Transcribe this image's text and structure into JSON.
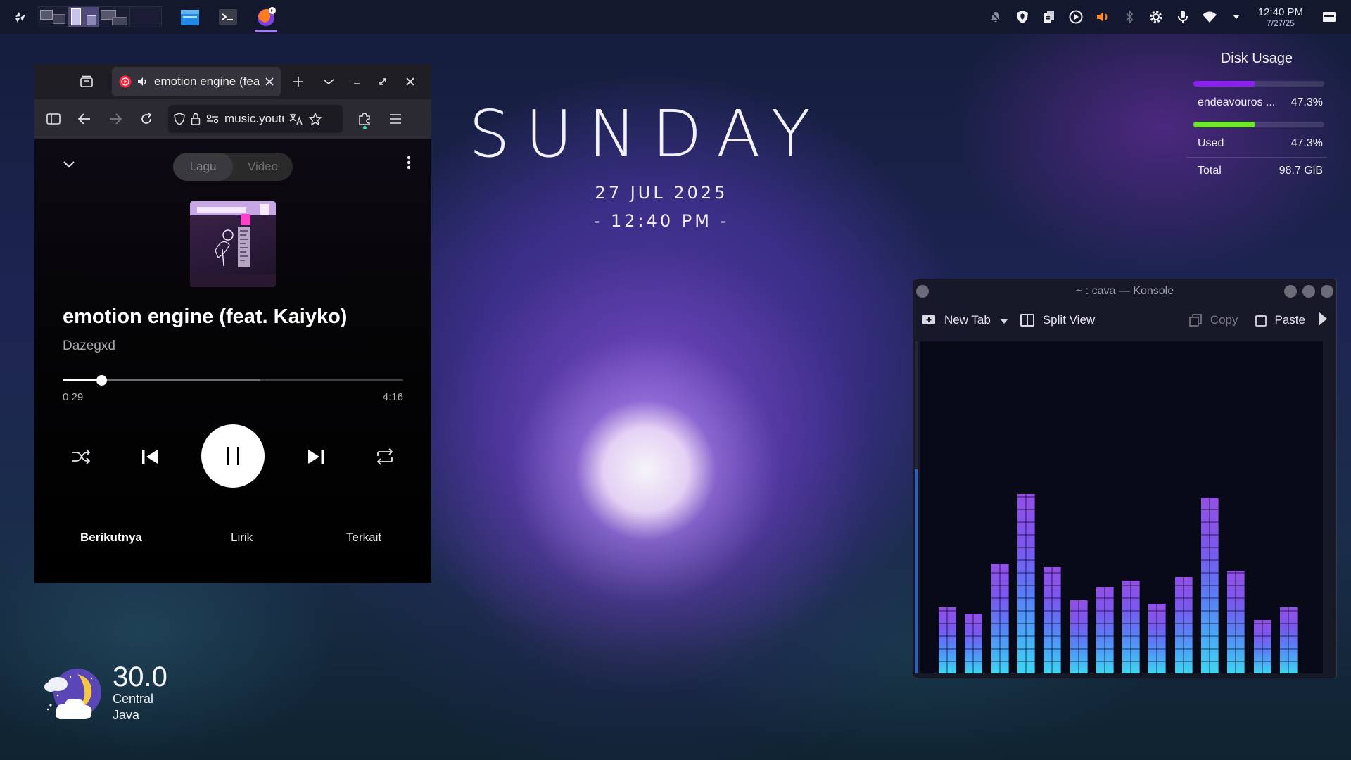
{
  "panel": {
    "clock_time": "12:40 PM",
    "clock_date": "7/27/25"
  },
  "desktop_clock": {
    "day": "SUNDAY",
    "date": "27 JUL 2025",
    "time": "- 12:40 PM -"
  },
  "disk_usage": {
    "title": "Disk Usage",
    "partition_name": "endeavouros ...",
    "partition_percent": "47.3%",
    "partition_fill": 0.473,
    "partition_color": "#8b1ff0",
    "used_label": "Used",
    "used_percent": "47.3%",
    "used_fill": 0.473,
    "used_color": "#6ee82a",
    "total_label": "Total",
    "total_value": "98.7 GiB"
  },
  "browser": {
    "tab_title": "emotion engine (feat. Kaiyko) - YouTube Music",
    "url": "music.youtube.com"
  },
  "player": {
    "tabs": [
      {
        "label": "Lagu"
      },
      {
        "label": "Video"
      }
    ],
    "song_title": "emotion engine (feat. Kaiyko)",
    "artist": "Dazegxd",
    "current_time": "0:29",
    "total_time": "4:16",
    "progress": 0.113,
    "bottom_tabs": [
      {
        "label": "Berikutnya"
      },
      {
        "label": "Lirik"
      },
      {
        "label": "Terkait"
      }
    ]
  },
  "konsole": {
    "title": "~ : cava — Konsole",
    "new_tab": "New Tab",
    "split_view": "Split View",
    "copy": "Copy",
    "paste": "Paste",
    "bar_levels": [
      0.2,
      0.18,
      0.33,
      0.54,
      0.32,
      0.22,
      0.26,
      0.28,
      0.21,
      0.29,
      0.53,
      0.31,
      0.16,
      0.2
    ]
  },
  "weather": {
    "temperature": "30.0",
    "location": "Central Java",
    "icon": "partly-cloudy-night-icon"
  }
}
